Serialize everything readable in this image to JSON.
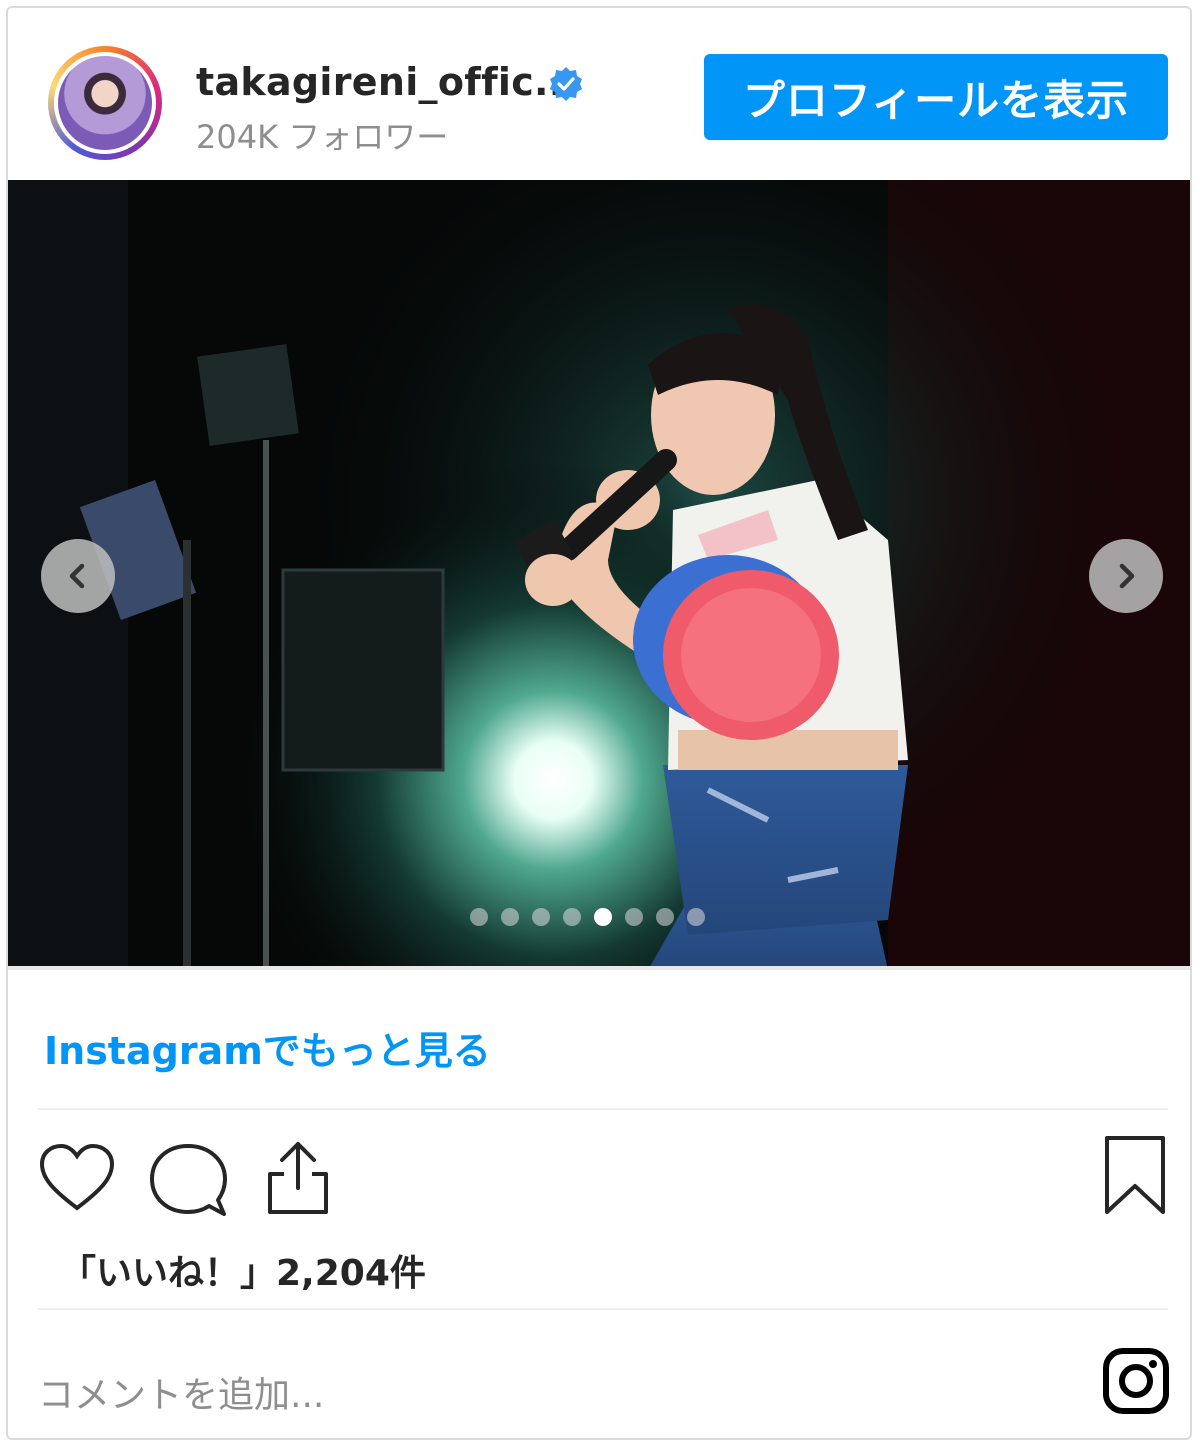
{
  "header": {
    "username": "takagireni_offic...",
    "followers": "204K フォロワー",
    "profile_button": "プロフィールを表示",
    "verified_icon": "verified-badge-icon"
  },
  "carousel": {
    "prev_icon": "chevron-left-icon",
    "next_icon": "chevron-right-icon",
    "slide_count": 8,
    "active_index": 4
  },
  "more_link": "Instagramでもっと見る",
  "actions": {
    "like_icon": "heart-icon",
    "comment_icon": "comment-bubble-icon",
    "share_icon": "share-icon",
    "save_icon": "bookmark-icon"
  },
  "likes": "「いいね！」2,204件",
  "comment": {
    "placeholder": "コメントを追加...",
    "instagram_icon": "instagram-logo-icon"
  },
  "colors": {
    "accent": "#0095f6",
    "border": "#dbdbdb",
    "muted": "#8e8e8e",
    "text": "#262626"
  }
}
